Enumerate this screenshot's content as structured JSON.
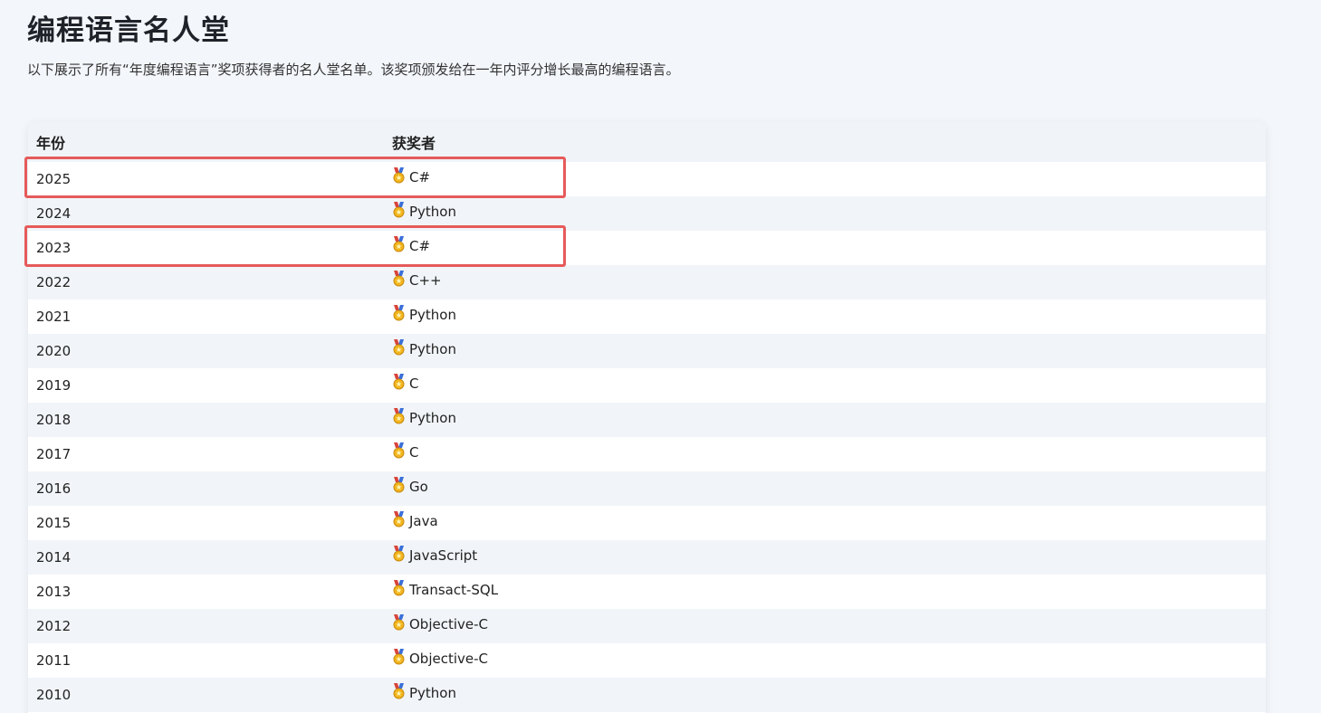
{
  "page": {
    "title": "编程语言名人堂",
    "description": "以下展示了所有“年度编程语言”奖项获得者的名人堂名单。该奖项颁发给在一年内评分增长最高的编程语言。"
  },
  "table": {
    "columns": [
      "年份",
      "获奖者"
    ],
    "rows": [
      {
        "year": "2025",
        "winner": "C#",
        "icon": "medal-icon",
        "highlighted": true
      },
      {
        "year": "2024",
        "winner": "Python",
        "icon": "medal-icon",
        "highlighted": false
      },
      {
        "year": "2023",
        "winner": "C#",
        "icon": "medal-icon",
        "highlighted": true
      },
      {
        "year": "2022",
        "winner": "C++",
        "icon": "medal-icon",
        "highlighted": false
      },
      {
        "year": "2021",
        "winner": "Python",
        "icon": "medal-icon",
        "highlighted": false
      },
      {
        "year": "2020",
        "winner": "Python",
        "icon": "medal-icon",
        "highlighted": false
      },
      {
        "year": "2019",
        "winner": "C",
        "icon": "medal-icon",
        "highlighted": false
      },
      {
        "year": "2018",
        "winner": "Python",
        "icon": "medal-icon",
        "highlighted": false
      },
      {
        "year": "2017",
        "winner": "C",
        "icon": "medal-icon",
        "highlighted": false
      },
      {
        "year": "2016",
        "winner": "Go",
        "icon": "medal-icon",
        "highlighted": false
      },
      {
        "year": "2015",
        "winner": "Java",
        "icon": "medal-icon",
        "highlighted": false
      },
      {
        "year": "2014",
        "winner": "JavaScript",
        "icon": "medal-icon",
        "highlighted": false
      },
      {
        "year": "2013",
        "winner": "Transact-SQL",
        "icon": "medal-icon",
        "highlighted": false
      },
      {
        "year": "2012",
        "winner": "Objective-C",
        "icon": "medal-icon",
        "highlighted": false
      },
      {
        "year": "2011",
        "winner": "Objective-C",
        "icon": "medal-icon",
        "highlighted": false
      },
      {
        "year": "2010",
        "winner": "Python",
        "icon": "medal-icon",
        "highlighted": false
      }
    ]
  },
  "colors": {
    "highlight_border": "#e65a5a",
    "header_bg": "#f0f4f8",
    "stripe_bg": "#f1f5f9",
    "page_bg": "#f3f6fa"
  }
}
